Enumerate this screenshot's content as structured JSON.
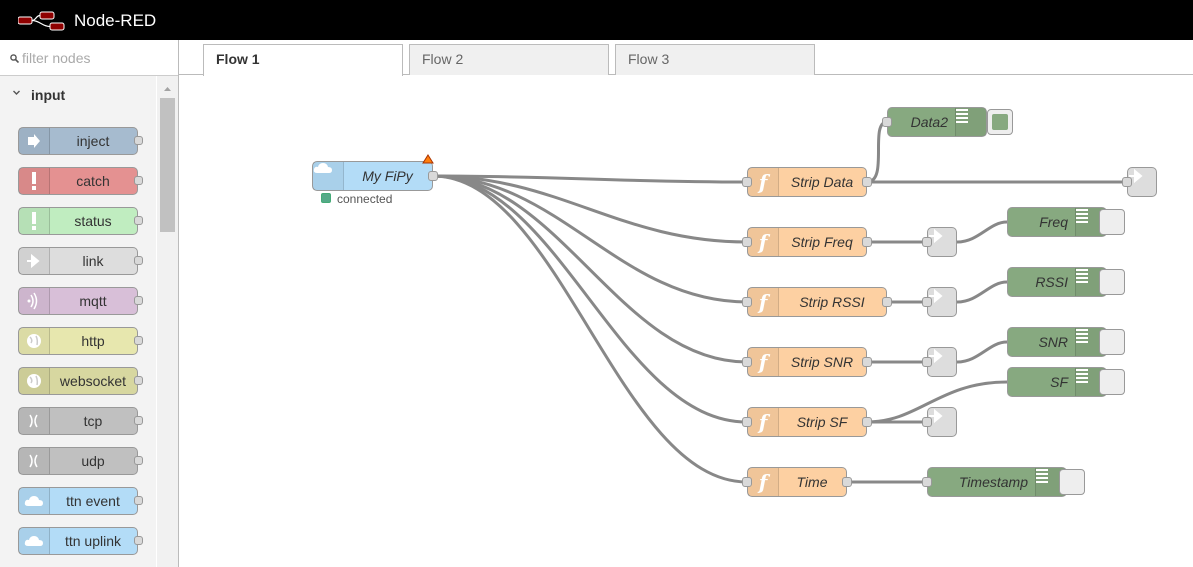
{
  "app": {
    "title": "Node-RED"
  },
  "palette": {
    "filter_placeholder": "filter nodes",
    "category": "input",
    "nodes": [
      {
        "label": "inject",
        "color": "#a6bbcf",
        "icon": "inject-arrow-icon"
      },
      {
        "label": "catch",
        "color": "#e49191",
        "icon": "exclamation-icon"
      },
      {
        "label": "status",
        "color": "#c0edc0",
        "icon": "exclamation-icon"
      },
      {
        "label": "link",
        "color": "#dddddd",
        "icon": "link-arrow-icon"
      },
      {
        "label": "mqtt",
        "color": "#d8bfd8",
        "icon": "radio-waves-icon"
      },
      {
        "label": "http",
        "color": "#e7e7ae",
        "icon": "globe-icon"
      },
      {
        "label": "websocket",
        "color": "#d7d7a0",
        "icon": "globe-icon"
      },
      {
        "label": "tcp",
        "color": "#c0c0c0",
        "icon": "bridge-icon"
      },
      {
        "label": "udp",
        "color": "#c0c0c0",
        "icon": "bridge-icon"
      },
      {
        "label": "ttn event",
        "color": "#b3dcf7",
        "icon": "cloud-icon"
      },
      {
        "label": "ttn uplink",
        "color": "#b3dcf7",
        "icon": "cloud-icon"
      }
    ]
  },
  "tabs": [
    {
      "label": "Flow 1",
      "active": true
    },
    {
      "label": "Flow 2",
      "active": false
    },
    {
      "label": "Flow 3",
      "active": false
    }
  ],
  "flow": {
    "source": {
      "label": "My FiPy",
      "status": "connected",
      "color": "#b3dcf7"
    },
    "functions": [
      {
        "label": "Strip Data"
      },
      {
        "label": "Strip Freq"
      },
      {
        "label": "Strip RSSI"
      },
      {
        "label": "Strip SNR"
      },
      {
        "label": "Strip SF"
      },
      {
        "label": "Time"
      }
    ],
    "debugs": [
      {
        "label": "Data2",
        "active": true
      },
      {
        "label": "Freq",
        "active": false
      },
      {
        "label": "RSSI",
        "active": false
      },
      {
        "label": "SNR",
        "active": false
      },
      {
        "label": "SF",
        "active": false
      },
      {
        "label": "Timestamp",
        "active": false
      }
    ],
    "function_color": "#fdd0a2",
    "debug_color": "#87a980",
    "wire_color": "#888888"
  }
}
